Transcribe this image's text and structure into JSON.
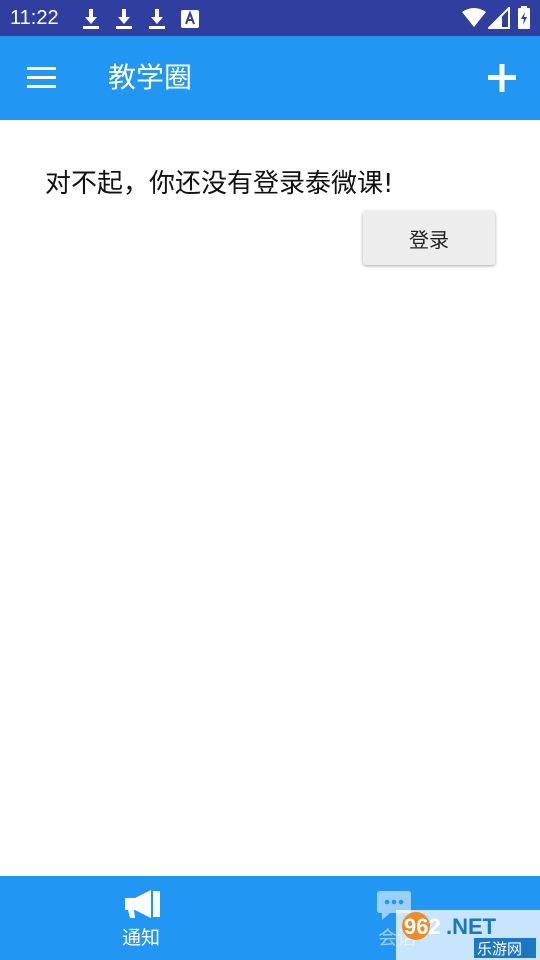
{
  "status_bar": {
    "time": "11:22",
    "icons": [
      "download-icon",
      "download-icon",
      "download-icon",
      "text-a-icon",
      "wifi-icon",
      "cell-signal-icon",
      "battery-icon"
    ]
  },
  "toolbar": {
    "title": "教学圈",
    "menu_icon": "hamburger-menu-icon",
    "add_icon": "plus-icon"
  },
  "content": {
    "message": "对不起，你还没有登录泰微课!",
    "login_button_label": "登录"
  },
  "bottom_nav": {
    "items": [
      {
        "label": "通知",
        "icon": "megaphone-icon"
      },
      {
        "label": "会话",
        "icon": "chat-bubble-icon"
      }
    ]
  },
  "watermark": {
    "brand_text": "962.NET",
    "sub_text": "乐游网"
  },
  "colors": {
    "status_bar": "#303f9f",
    "primary": "#2196f3",
    "background": "#ffffff",
    "button": "#ededed"
  }
}
